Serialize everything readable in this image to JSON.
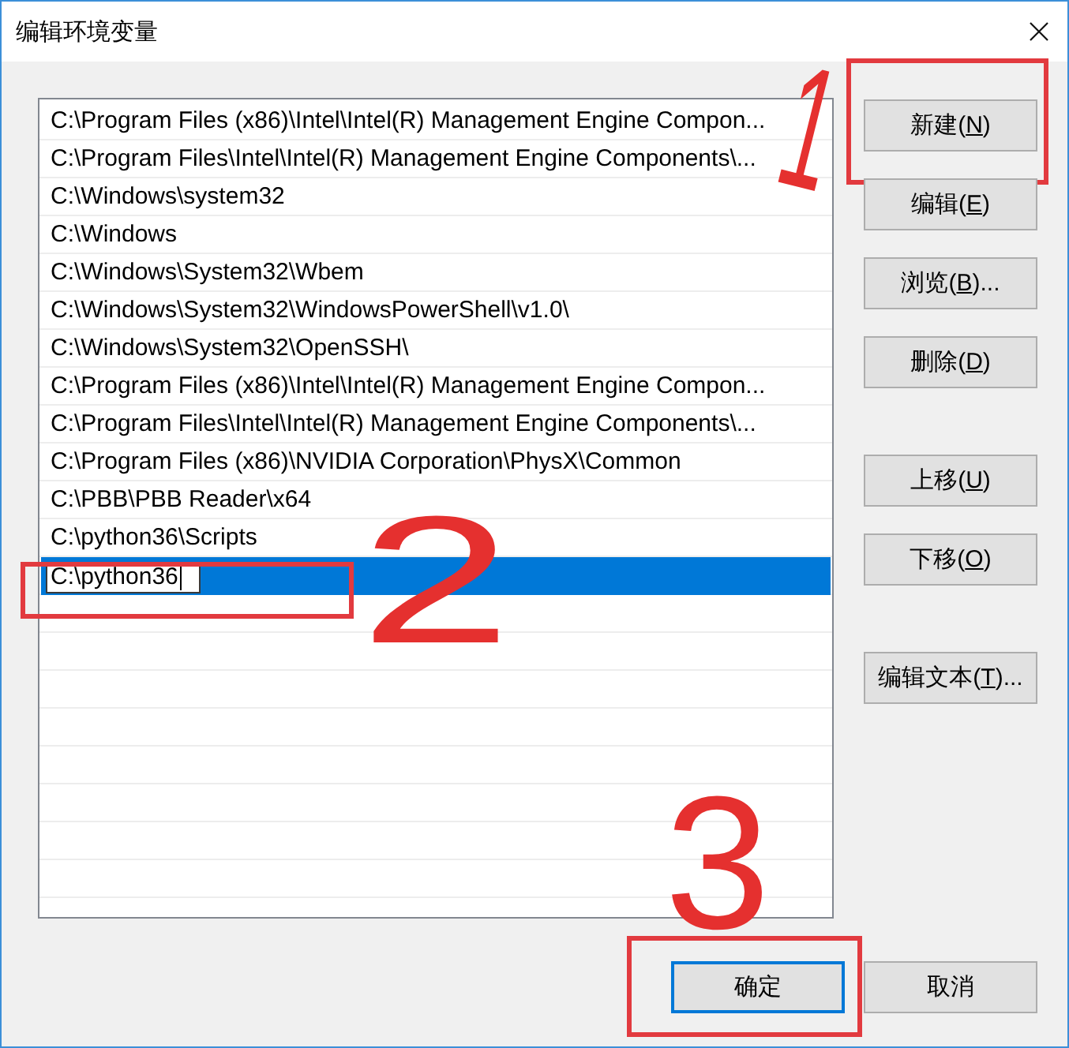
{
  "window": {
    "title": "编辑环境变量"
  },
  "path_list": {
    "items": [
      {
        "text": "C:\\Program Files (x86)\\Intel\\Intel(R) Management Engine Compon...",
        "selected": false,
        "editing": false
      },
      {
        "text": "C:\\Program Files\\Intel\\Intel(R) Management Engine Components\\...",
        "selected": false,
        "editing": false
      },
      {
        "text": "C:\\Windows\\system32",
        "selected": false,
        "editing": false
      },
      {
        "text": "C:\\Windows",
        "selected": false,
        "editing": false
      },
      {
        "text": "C:\\Windows\\System32\\Wbem",
        "selected": false,
        "editing": false
      },
      {
        "text": "C:\\Windows\\System32\\WindowsPowerShell\\v1.0\\",
        "selected": false,
        "editing": false
      },
      {
        "text": "C:\\Windows\\System32\\OpenSSH\\",
        "selected": false,
        "editing": false
      },
      {
        "text": "C:\\Program Files (x86)\\Intel\\Intel(R) Management Engine Compon...",
        "selected": false,
        "editing": false
      },
      {
        "text": "C:\\Program Files\\Intel\\Intel(R) Management Engine Components\\...",
        "selected": false,
        "editing": false
      },
      {
        "text": "C:\\Program Files (x86)\\NVIDIA Corporation\\PhysX\\Common",
        "selected": false,
        "editing": false
      },
      {
        "text": "C:\\PBB\\PBB Reader\\x64",
        "selected": false,
        "editing": false
      },
      {
        "text": "C:\\python36\\Scripts",
        "selected": false,
        "editing": false
      },
      {
        "text": "C:\\python36",
        "selected": true,
        "editing": true,
        "annotation": "2"
      }
    ]
  },
  "side_buttons": [
    {
      "buttons": [
        {
          "label": "新建(",
          "access_key": "N",
          "suffix": ")",
          "annotation": "1"
        },
        {
          "label": "编辑(",
          "access_key": "E",
          "suffix": ")"
        },
        {
          "label": "浏览(",
          "access_key": "B",
          "suffix": ")..."
        },
        {
          "label": "删除(",
          "access_key": "D",
          "suffix": ")"
        }
      ]
    },
    {
      "buttons": [
        {
          "label": "上移(",
          "access_key": "U",
          "suffix": ")"
        },
        {
          "label": "下移(",
          "access_key": "O",
          "suffix": ")"
        }
      ]
    },
    {
      "buttons": [
        {
          "label": "编辑文本(",
          "access_key": "T",
          "suffix": ")..."
        }
      ]
    }
  ],
  "footer_buttons": [
    {
      "label": "确定",
      "default": true,
      "annotation": "3"
    },
    {
      "label": "取消",
      "default": false
    }
  ]
}
